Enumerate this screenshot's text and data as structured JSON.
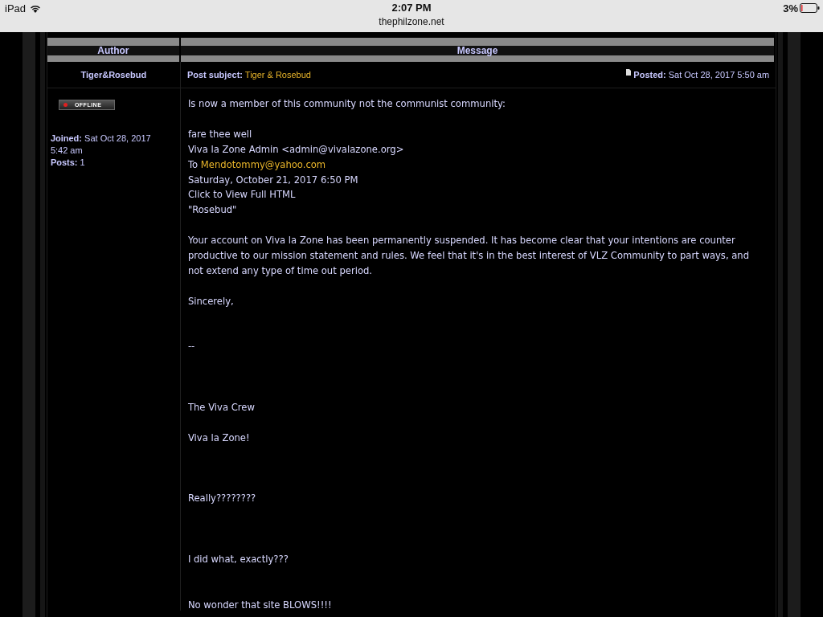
{
  "status_bar": {
    "device": "iPad",
    "time": "2:07 PM",
    "url": "thephilzone.net",
    "battery": "3%"
  },
  "table": {
    "columns": [
      "Author",
      "Message"
    ]
  },
  "post": {
    "author": "Tiger&Rosebud",
    "subject_label": "Post subject:",
    "subject": "Tiger & Rosebud",
    "posted_label": "Posted:",
    "posted": "Sat Oct 28, 2017 5:50 am",
    "status": "OFFLINE",
    "online": false,
    "profile": [
      {
        "label": "Joined:",
        "value": "Sat Oct 28, 2017 5:42 am"
      },
      {
        "label": "Posts:",
        "value": "1"
      }
    ],
    "message": [
      {
        "kind": "text",
        "text": "Is now a member of this community not the communist community:"
      },
      {
        "kind": "blank"
      },
      {
        "kind": "text",
        "text": "fare thee well"
      },
      {
        "kind": "text",
        "text": "Viva la Zone Admin <admin@vivalazone.org>"
      },
      {
        "kind": "link",
        "text": "To",
        "link": "Mendotommy@yahoo.com"
      },
      {
        "kind": "text",
        "text": "Saturday, October 21, 2017 6:50 PM"
      },
      {
        "kind": "text",
        "text": "Click to View Full HTML"
      },
      {
        "kind": "text",
        "text": "\"Rosebud\""
      },
      {
        "kind": "blank"
      },
      {
        "kind": "text",
        "text": "Your account on Viva la Zone has been permanently suspended. It has become clear that your intentions are counter productive to our mission statement and rules. We feel that it's in the best interest of VLZ Community to part ways, and not extend any type of time out period."
      },
      {
        "kind": "blank"
      },
      {
        "kind": "text",
        "text": "Sincerely,"
      },
      {
        "kind": "blank"
      },
      {
        "kind": "blank"
      },
      {
        "kind": "text",
        "text": "--"
      },
      {
        "kind": "blank"
      },
      {
        "kind": "blank"
      },
      {
        "kind": "blank"
      },
      {
        "kind": "text",
        "text": "The Viva Crew"
      },
      {
        "kind": "blank"
      },
      {
        "kind": "text",
        "text": "Viva la Zone!"
      },
      {
        "kind": "blank"
      },
      {
        "kind": "blank"
      },
      {
        "kind": "blank"
      },
      {
        "kind": "text",
        "text": "Really????????"
      },
      {
        "kind": "blank"
      },
      {
        "kind": "blank"
      },
      {
        "kind": "blank"
      },
      {
        "kind": "text",
        "text": "I did what, exactly???"
      },
      {
        "kind": "blank"
      },
      {
        "kind": "blank"
      },
      {
        "kind": "text",
        "text": "No wonder that site BLOWS!!!!"
      }
    ]
  }
}
